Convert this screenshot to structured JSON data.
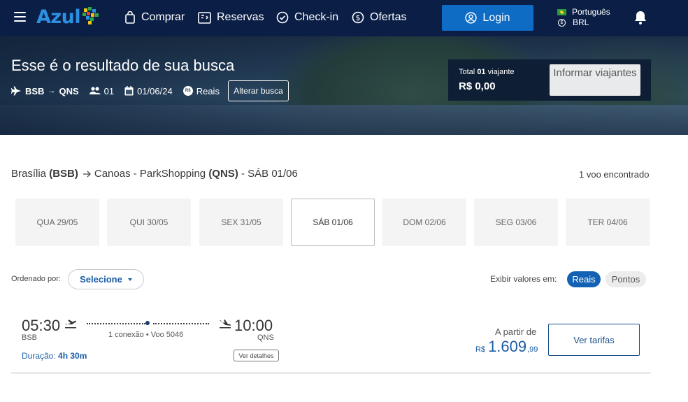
{
  "header": {
    "logo": "Azul",
    "nav": [
      {
        "label": "Comprar",
        "icon": "bag-icon"
      },
      {
        "label": "Reservas",
        "icon": "reservations-icon"
      },
      {
        "label": "Check-in",
        "icon": "check-circle-icon"
      },
      {
        "label": "Ofertas",
        "icon": "dollar-circle-icon"
      }
    ],
    "login_label": "Login",
    "language": "Português",
    "currency": "BRL"
  },
  "hero": {
    "title": "Esse é o resultado de sua busca",
    "origin": "BSB",
    "destination": "QNS",
    "passengers": "01",
    "date": "01/06/24",
    "currency_label": "Reais",
    "currency_badge": "R$",
    "alterar_label": "Alterar busca",
    "total_prefix": "Total",
    "total_count": "01",
    "total_suffix": "viajante",
    "total_value": "R$ 0,00",
    "informar_label": "Informar viajantes"
  },
  "route": {
    "origin_city": "Brasília",
    "origin_code": "(BSB)",
    "dest_city": "Canoas - ParkShopping",
    "dest_code": "(QNS)",
    "date_suffix": "- SÁB 01/06",
    "found": "1 voo encontrado"
  },
  "dates": [
    {
      "label": "QUA 29/05",
      "active": false
    },
    {
      "label": "QUI 30/05",
      "active": false
    },
    {
      "label": "SEX 31/05",
      "active": false
    },
    {
      "label": "SÁB 01/06",
      "active": true
    },
    {
      "label": "DOM 02/06",
      "active": false
    },
    {
      "label": "SEG 03/06",
      "active": false
    },
    {
      "label": "TER 04/06",
      "active": false
    }
  ],
  "sort": {
    "label": "Ordenado por:",
    "selected": "Selecione"
  },
  "values": {
    "label": "Exibir valores em:",
    "options": [
      "Reais",
      "Pontos"
    ],
    "selected": "Reais"
  },
  "flight": {
    "dep_time": "05:30",
    "dep_code": "BSB",
    "arr_time": "10:00",
    "arr_code": "QNS",
    "connection": "1 conexão • Voo 5046",
    "duration_label": "Duração:",
    "duration": "4h 30m",
    "details_label": "Ver detalhes",
    "from_label": "A partir de",
    "price_currency": "R$",
    "price_int": "1.609",
    "price_cents": ",99",
    "fares_label": "Ver tarifas"
  },
  "colors": {
    "nav_bg": "#0a1e46",
    "brand_blue": "#0e6cc4",
    "accent_blue": "#1b5ea6"
  }
}
